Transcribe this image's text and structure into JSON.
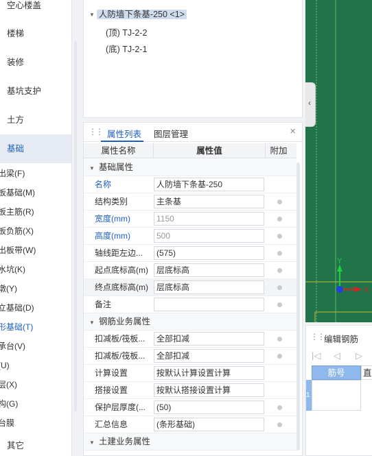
{
  "left_nav": {
    "categories": [
      {
        "label": "空心楼盖",
        "active": false
      },
      {
        "label": "楼梯",
        "active": false
      },
      {
        "label": "装修",
        "active": false
      },
      {
        "label": "基坑支护",
        "active": false
      },
      {
        "label": "土方",
        "active": false
      },
      {
        "label": "基础",
        "active": true
      },
      {
        "label": "其它",
        "active": false
      }
    ],
    "sub_items": [
      {
        "label": "出梁(F)",
        "active": false
      },
      {
        "label": "板基础(M)",
        "active": false
      },
      {
        "label": "板主筋(R)",
        "active": false
      },
      {
        "label": "板负筋(X)",
        "active": false
      },
      {
        "label": "出板带(W)",
        "active": false
      },
      {
        "label": "水坑(K)",
        "active": false
      },
      {
        "label": "墩(Y)",
        "active": false
      },
      {
        "label": "立基础(D)",
        "active": false
      },
      {
        "label": "形基础(T)",
        "active": true
      },
      {
        "label": "承台(V)",
        "active": false
      },
      {
        "label": "(U)",
        "active": false
      },
      {
        "label": "层(X)",
        "active": false
      },
      {
        "label": "构(G)",
        "active": false
      },
      {
        "label": "台膜",
        "active": false
      }
    ]
  },
  "tree": {
    "selected_label": "人防墙下条基-250 <1>",
    "children": [
      "(顶) TJ-2-2",
      "(底) TJ-2-1"
    ]
  },
  "props_panel": {
    "tabs": [
      {
        "label": "属性列表",
        "active": true
      },
      {
        "label": "图层管理",
        "active": false
      }
    ],
    "close_symbol": "×",
    "columns": {
      "name": "属性名称",
      "value": "属性值",
      "extra": "附加"
    },
    "rows": [
      {
        "type": "group",
        "label": "基础属性"
      },
      {
        "type": "prop",
        "name": "名称",
        "value": "人防墙下条基-250",
        "blue": true,
        "disabled": false,
        "dot": false
      },
      {
        "type": "prop",
        "name": "结构类别",
        "value": "主条基",
        "blue": false,
        "disabled": false,
        "dot": true
      },
      {
        "type": "prop",
        "name": "宽度(mm)",
        "value": "1150",
        "blue": true,
        "disabled": true,
        "dot": true
      },
      {
        "type": "prop",
        "name": "高度(mm)",
        "value": "500",
        "blue": true,
        "disabled": true,
        "dot": true
      },
      {
        "type": "prop",
        "name": "轴线距左边...",
        "value": "(575)",
        "blue": false,
        "disabled": false,
        "dot": true
      },
      {
        "type": "prop",
        "name": "起点底标高(m)",
        "value": "层底标高",
        "blue": false,
        "disabled": false,
        "dot": true
      },
      {
        "type": "prop",
        "name": "终点底标高(m)",
        "value": "层底标高",
        "blue": false,
        "disabled": false,
        "dot": true,
        "highlight": true
      },
      {
        "type": "prop",
        "name": "备注",
        "value": "",
        "blue": false,
        "disabled": false,
        "dot": true
      },
      {
        "type": "group",
        "label": "钢筋业务属性"
      },
      {
        "type": "prop",
        "name": "扣减板/筏板...",
        "value": "全部扣减",
        "blue": false,
        "disabled": false,
        "dot": true
      },
      {
        "type": "prop",
        "name": "扣减板/筏板...",
        "value": "全部扣减",
        "blue": false,
        "disabled": false,
        "dot": true
      },
      {
        "type": "prop",
        "name": "计算设置",
        "value": "按默认计算设置计算",
        "blue": false,
        "disabled": false,
        "dot": false
      },
      {
        "type": "prop",
        "name": "搭接设置",
        "value": "按默认搭接设置计算",
        "blue": false,
        "disabled": false,
        "dot": false
      },
      {
        "type": "prop",
        "name": "保护层厚度(...",
        "value": "(50)",
        "blue": false,
        "disabled": false,
        "dot": true
      },
      {
        "type": "prop",
        "name": "汇总信息",
        "value": "(条形基础)",
        "blue": false,
        "disabled": false,
        "dot": true
      },
      {
        "type": "group",
        "label": "土建业务属性"
      }
    ]
  },
  "canvas": {
    "axis_y": "Y",
    "axis_x": "X",
    "bg_color": "#21744a",
    "collapse_icon": "chevron-left-icon"
  },
  "rebar_panel": {
    "title": "编辑钢筋",
    "col_number": "筋号",
    "col_partial": "直径",
    "row_index": "1"
  },
  "colors": {
    "accent": "#1f5fbf",
    "canvas_green": "#21744a",
    "axis_red": "#e02020",
    "axis_green": "#20d040",
    "axis_blue": "#2040e0"
  }
}
